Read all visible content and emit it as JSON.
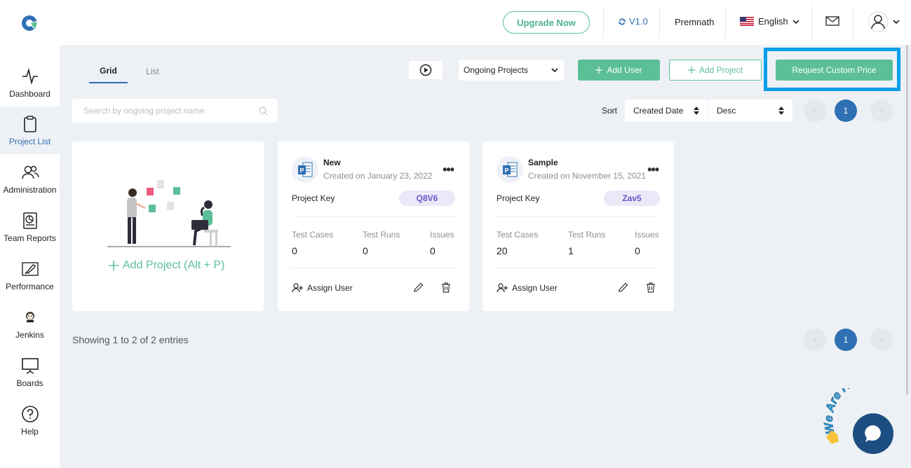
{
  "header": {
    "upgrade_label": "Upgrade Now",
    "version_label": "V1.0",
    "user_name": "Premnath",
    "language": "English"
  },
  "sidebar": {
    "items": [
      {
        "label": "Dashboard",
        "icon": "pulse-icon"
      },
      {
        "label": "Project List",
        "icon": "clipboard-icon"
      },
      {
        "label": "Administration",
        "icon": "users-icon"
      },
      {
        "label": "Team Reports",
        "icon": "report-icon"
      },
      {
        "label": "Performance",
        "icon": "rocket-icon"
      },
      {
        "label": "Jenkins",
        "icon": "jenkins-icon"
      },
      {
        "label": "Boards",
        "icon": "board-icon"
      },
      {
        "label": "Help",
        "icon": "help-icon"
      }
    ],
    "active_index": 1
  },
  "toolbar": {
    "tabs": [
      "Grid",
      "List"
    ],
    "status_filter": "Ongoing Projects",
    "add_user_label": "Add User",
    "add_project_label": "Add Project",
    "custom_price_label": "Request Custom Price",
    "search_placeholder": "Search by ongoing project name",
    "sort_label": "Sort",
    "sort_field": "Created Date",
    "sort_order": "Desc",
    "current_page": "1"
  },
  "add_card": {
    "label": "Add Project (Alt + P)"
  },
  "projects": [
    {
      "name": "New",
      "created": "Created on January 23, 2022",
      "key_label": "Project Key",
      "key": "Q8V6",
      "stats": [
        {
          "label": "Test Cases",
          "value": "0"
        },
        {
          "label": "Test Runs",
          "value": "0"
        },
        {
          "label": "Issues",
          "value": "0"
        }
      ],
      "assign_label": "Assign User"
    },
    {
      "name": "Sample",
      "created": "Created on November 15, 2021",
      "key_label": "Project Key",
      "key": "Zav5",
      "stats": [
        {
          "label": "Test Cases",
          "value": "20"
        },
        {
          "label": "Test Runs",
          "value": "1"
        },
        {
          "label": "Issues",
          "value": "0"
        }
      ],
      "assign_label": "Assign User"
    }
  ],
  "footer": {
    "entries_text": "Showing 1 to 2 of 2 entries",
    "current_page": "1"
  },
  "chat": {
    "banner_text": "We Are Here!"
  },
  "colors": {
    "accent_green": "#5cbf98",
    "accent_blue": "#2f6fb3",
    "highlight": "#0a9ee8",
    "badge_purple": "#6a55c9"
  }
}
